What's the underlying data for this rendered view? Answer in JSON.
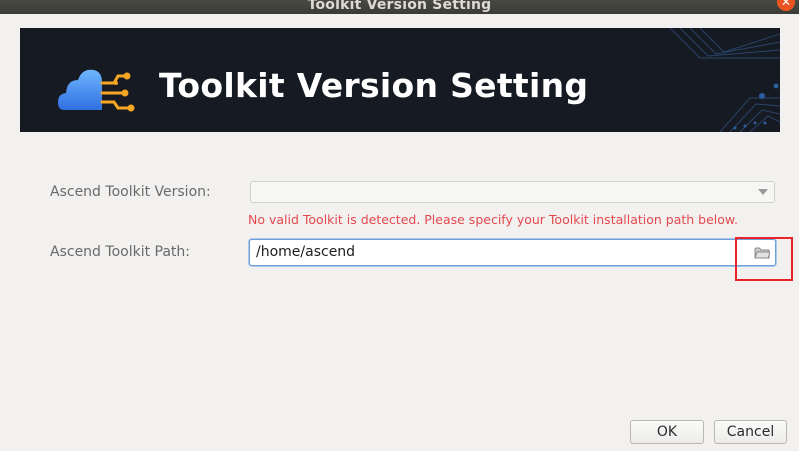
{
  "window": {
    "title": "Toolkit Version Setting"
  },
  "banner": {
    "heading": "Toolkit Version Setting"
  },
  "form": {
    "version_label": "Ascend Toolkit Version:",
    "version_value": "",
    "error_message": "No valid Toolkit is detected. Please specify your Toolkit installation path below.",
    "path_label": "Ascend Toolkit Path:",
    "path_value": "/home/ascend"
  },
  "buttons": {
    "ok": "OK",
    "cancel": "Cancel"
  },
  "colors": {
    "banner_bg": "#161a23",
    "error_text": "#e5484d",
    "highlight": "#e8232a",
    "close_button": "#e95420"
  },
  "icons": {
    "close": "close-icon",
    "browse": "folder-icon",
    "logo": "cloud-circuit-logo-icon",
    "dropdown": "chevron-down-icon"
  }
}
